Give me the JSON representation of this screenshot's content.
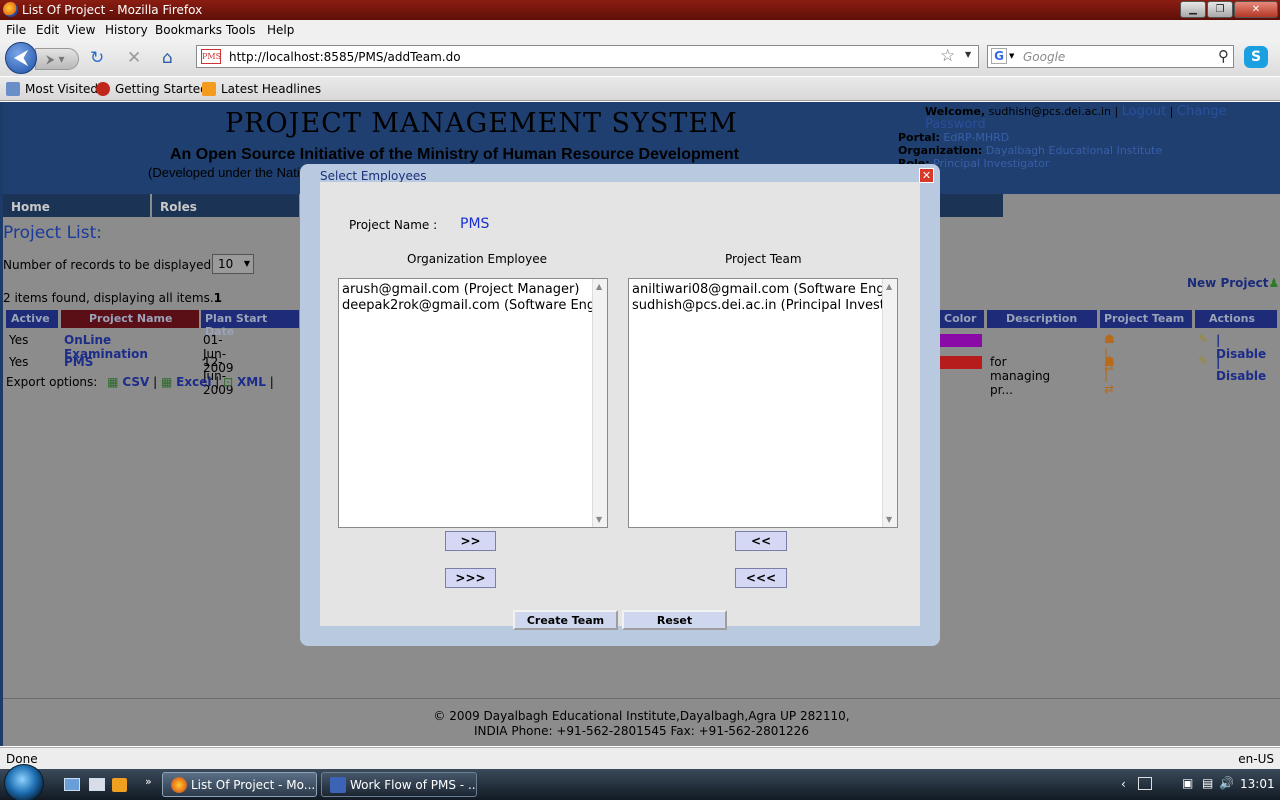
{
  "window": {
    "title": "List Of Project - Mozilla Firefox",
    "controls": [
      "▁",
      "❐",
      "✕"
    ]
  },
  "menu": [
    "File",
    "Edit",
    "View",
    "History",
    "Bookmarks",
    "Tools",
    "Help"
  ],
  "nav": {
    "url": "http://localhost:8585/PMS/addTeam.do",
    "search_placeholder": "Google",
    "favicon_text": "PMS"
  },
  "bookmarks": [
    "Most Visited",
    "Getting Started",
    "Latest Headlines"
  ],
  "header": {
    "title": "PROJECT MANAGEMENT SYSTEM",
    "subtitle": "An Open Source Initiative of the Ministry of Human Resource Development",
    "subtitle2": "(Developed under the Natio",
    "welcome_label": "Welcome,",
    "user_email": "sudhish@pcs.dei.ac.in",
    "logout": "Logout",
    "change_password": "Change Password",
    "portal_label": "Portal:",
    "portal": "EdRP-MHRD",
    "org_label": "Organization:",
    "org": "Dayalbagh Educational Institute",
    "role_label": "Role:",
    "role": "Principal Investigator"
  },
  "main_nav": [
    "Home",
    "Roles"
  ],
  "list": {
    "title": "Project List:",
    "records_label": "Number of records to be displayed:",
    "records_value": "10",
    "found_text": "2 items found, displaying all items.",
    "found_page": "1",
    "new_project": "New Project",
    "columns": [
      "Active",
      "Project Name",
      "Plan Start Date",
      "Color",
      "Description",
      "Project Team",
      "Actions"
    ],
    "rows": [
      {
        "active": "Yes",
        "name": "OnLine Examination",
        "start": "01-Jun-2009",
        "color": "#8a0aa8",
        "description": "",
        "action": "Disable"
      },
      {
        "active": "Yes",
        "name": "PMS",
        "start": "12-Jun-2009",
        "color": "#b71c1c",
        "description": "for managing pr...",
        "action": "Disable"
      }
    ],
    "export_label": "Export options:",
    "export_options": [
      "CSV",
      "Excel",
      "XML"
    ]
  },
  "footer": {
    "line1": "© 2009 Dayalbagh Educational Institute,Dayalbagh,Agra UP 282110,",
    "line2": "INDIA Phone: +91-562-2801545 Fax: +91-562-2801226"
  },
  "modal": {
    "title": "Select Employees",
    "project_name_label": "Project Name :",
    "project_name": "PMS",
    "left_heading": "Organization Employee",
    "right_heading": "Project Team",
    "left_items": [
      "arush@gmail.com (Project Manager)",
      "deepak2rok@gmail.com (Software Engine"
    ],
    "right_items": [
      "aniltiwari08@gmail.com (Software Enginee",
      "sudhish@pcs.dei.ac.in (Principal Investiga"
    ],
    "btn_add": ">>",
    "btn_add_all": ">>>",
    "btn_remove": "<<",
    "btn_remove_all": "<<<",
    "btn_create": "Create Team",
    "btn_reset": "Reset"
  },
  "status": {
    "text": "Done",
    "lang": "en-US"
  },
  "taskbar": {
    "tasks": [
      "List Of Project - Mo...",
      "Work Flow of PMS - ..."
    ],
    "clock": "13:01"
  }
}
